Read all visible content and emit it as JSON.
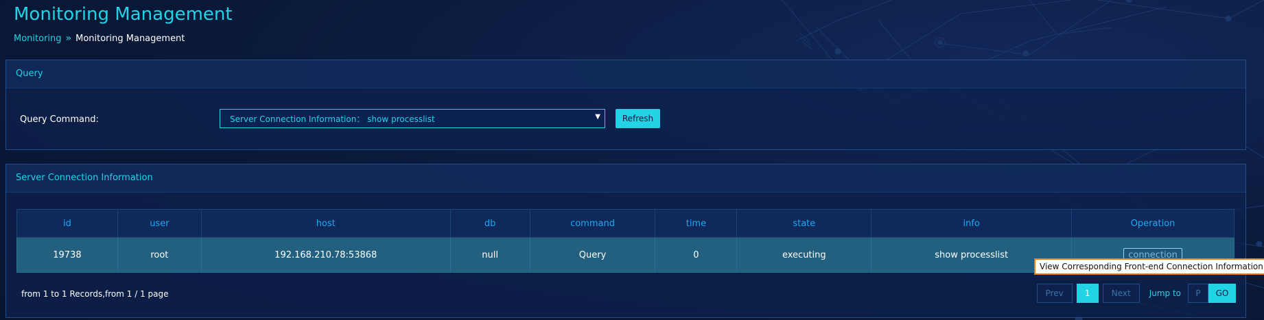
{
  "header": {
    "title": "Monitoring Management",
    "breadcrumb": {
      "parent": "Monitoring",
      "separator": "»",
      "current": "Monitoring Management"
    }
  },
  "query_panel": {
    "title": "Query",
    "command_label": "Query Command:",
    "select_value": "Server Connection Information： show processlist",
    "refresh_label": "Refresh"
  },
  "info_panel": {
    "title": "Server Connection Information",
    "columns": [
      "id",
      "user",
      "host",
      "db",
      "command",
      "time",
      "state",
      "info",
      "Operation"
    ],
    "rows": [
      {
        "id": "19738",
        "user": "root",
        "host": "192.168.210.78:53868",
        "db": "null",
        "command": "Query",
        "time": "0",
        "state": "executing",
        "info": "show processlist",
        "operation": "connection"
      }
    ],
    "summary": "from 1 to 1 Records,from 1 / 1 page",
    "pager": {
      "prev": "Prev",
      "current_page": "1",
      "next": "Next",
      "jump_label": "Jump to",
      "page_placeholder": "P",
      "go": "GO"
    }
  },
  "tooltip": "View Corresponding Front-end Connection Information",
  "colors": {
    "accent": "#22d3e6",
    "background": "#0b1a3c",
    "row_bg": "#23607f",
    "tooltip_border": "#e57c1f"
  }
}
